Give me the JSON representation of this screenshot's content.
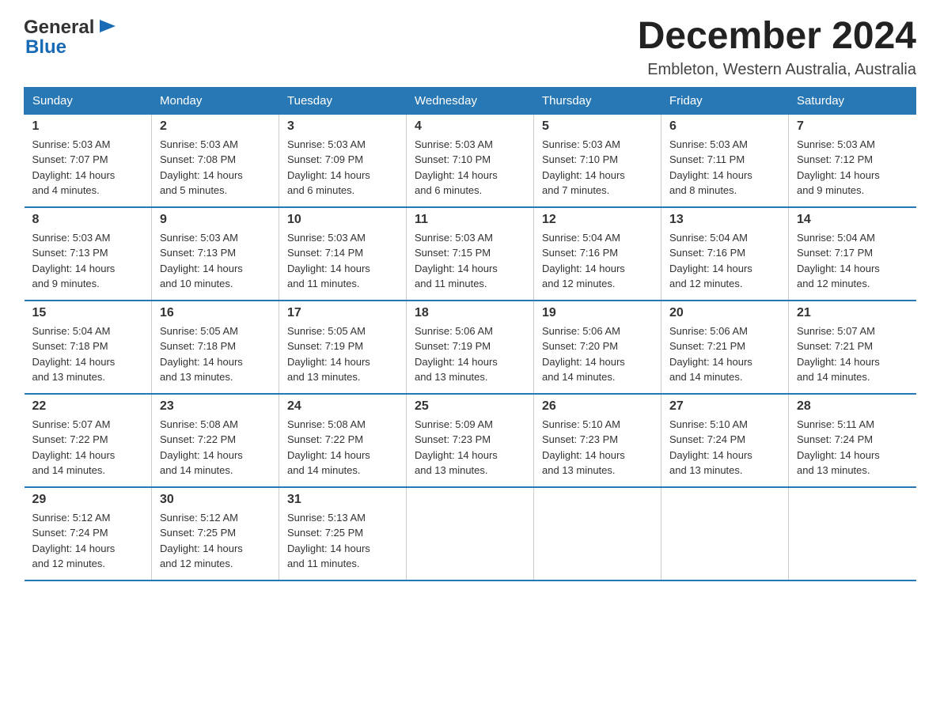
{
  "logo": {
    "text_general": "General",
    "text_blue": "Blue",
    "icon": "▶"
  },
  "title": "December 2024",
  "subtitle": "Embleton, Western Australia, Australia",
  "weekdays": [
    "Sunday",
    "Monday",
    "Tuesday",
    "Wednesday",
    "Thursday",
    "Friday",
    "Saturday"
  ],
  "weeks": [
    [
      {
        "day": "1",
        "sunrise": "5:03 AM",
        "sunset": "7:07 PM",
        "daylight": "14 hours and 4 minutes."
      },
      {
        "day": "2",
        "sunrise": "5:03 AM",
        "sunset": "7:08 PM",
        "daylight": "14 hours and 5 minutes."
      },
      {
        "day": "3",
        "sunrise": "5:03 AM",
        "sunset": "7:09 PM",
        "daylight": "14 hours and 6 minutes."
      },
      {
        "day": "4",
        "sunrise": "5:03 AM",
        "sunset": "7:10 PM",
        "daylight": "14 hours and 6 minutes."
      },
      {
        "day": "5",
        "sunrise": "5:03 AM",
        "sunset": "7:10 PM",
        "daylight": "14 hours and 7 minutes."
      },
      {
        "day": "6",
        "sunrise": "5:03 AM",
        "sunset": "7:11 PM",
        "daylight": "14 hours and 8 minutes."
      },
      {
        "day": "7",
        "sunrise": "5:03 AM",
        "sunset": "7:12 PM",
        "daylight": "14 hours and 9 minutes."
      }
    ],
    [
      {
        "day": "8",
        "sunrise": "5:03 AM",
        "sunset": "7:13 PM",
        "daylight": "14 hours and 9 minutes."
      },
      {
        "day": "9",
        "sunrise": "5:03 AM",
        "sunset": "7:13 PM",
        "daylight": "14 hours and 10 minutes."
      },
      {
        "day": "10",
        "sunrise": "5:03 AM",
        "sunset": "7:14 PM",
        "daylight": "14 hours and 11 minutes."
      },
      {
        "day": "11",
        "sunrise": "5:03 AM",
        "sunset": "7:15 PM",
        "daylight": "14 hours and 11 minutes."
      },
      {
        "day": "12",
        "sunrise": "5:04 AM",
        "sunset": "7:16 PM",
        "daylight": "14 hours and 12 minutes."
      },
      {
        "day": "13",
        "sunrise": "5:04 AM",
        "sunset": "7:16 PM",
        "daylight": "14 hours and 12 minutes."
      },
      {
        "day": "14",
        "sunrise": "5:04 AM",
        "sunset": "7:17 PM",
        "daylight": "14 hours and 12 minutes."
      }
    ],
    [
      {
        "day": "15",
        "sunrise": "5:04 AM",
        "sunset": "7:18 PM",
        "daylight": "14 hours and 13 minutes."
      },
      {
        "day": "16",
        "sunrise": "5:05 AM",
        "sunset": "7:18 PM",
        "daylight": "14 hours and 13 minutes."
      },
      {
        "day": "17",
        "sunrise": "5:05 AM",
        "sunset": "7:19 PM",
        "daylight": "14 hours and 13 minutes."
      },
      {
        "day": "18",
        "sunrise": "5:06 AM",
        "sunset": "7:19 PM",
        "daylight": "14 hours and 13 minutes."
      },
      {
        "day": "19",
        "sunrise": "5:06 AM",
        "sunset": "7:20 PM",
        "daylight": "14 hours and 14 minutes."
      },
      {
        "day": "20",
        "sunrise": "5:06 AM",
        "sunset": "7:21 PM",
        "daylight": "14 hours and 14 minutes."
      },
      {
        "day": "21",
        "sunrise": "5:07 AM",
        "sunset": "7:21 PM",
        "daylight": "14 hours and 14 minutes."
      }
    ],
    [
      {
        "day": "22",
        "sunrise": "5:07 AM",
        "sunset": "7:22 PM",
        "daylight": "14 hours and 14 minutes."
      },
      {
        "day": "23",
        "sunrise": "5:08 AM",
        "sunset": "7:22 PM",
        "daylight": "14 hours and 14 minutes."
      },
      {
        "day": "24",
        "sunrise": "5:08 AM",
        "sunset": "7:22 PM",
        "daylight": "14 hours and 14 minutes."
      },
      {
        "day": "25",
        "sunrise": "5:09 AM",
        "sunset": "7:23 PM",
        "daylight": "14 hours and 13 minutes."
      },
      {
        "day": "26",
        "sunrise": "5:10 AM",
        "sunset": "7:23 PM",
        "daylight": "14 hours and 13 minutes."
      },
      {
        "day": "27",
        "sunrise": "5:10 AM",
        "sunset": "7:24 PM",
        "daylight": "14 hours and 13 minutes."
      },
      {
        "day": "28",
        "sunrise": "5:11 AM",
        "sunset": "7:24 PM",
        "daylight": "14 hours and 13 minutes."
      }
    ],
    [
      {
        "day": "29",
        "sunrise": "5:12 AM",
        "sunset": "7:24 PM",
        "daylight": "14 hours and 12 minutes."
      },
      {
        "day": "30",
        "sunrise": "5:12 AM",
        "sunset": "7:25 PM",
        "daylight": "14 hours and 12 minutes."
      },
      {
        "day": "31",
        "sunrise": "5:13 AM",
        "sunset": "7:25 PM",
        "daylight": "14 hours and 11 minutes."
      },
      null,
      null,
      null,
      null
    ]
  ],
  "labels": {
    "sunrise": "Sunrise:",
    "sunset": "Sunset:",
    "daylight": "Daylight:"
  }
}
